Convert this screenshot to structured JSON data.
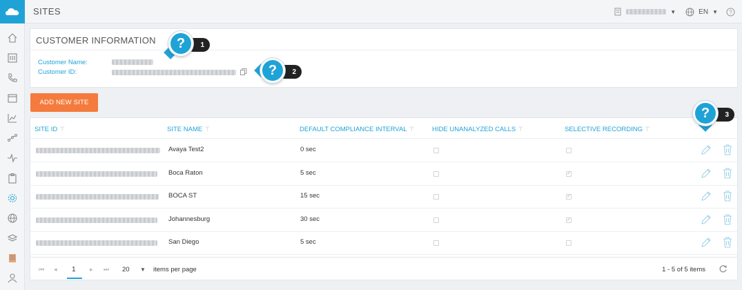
{
  "header": {
    "title": "SITES",
    "language": "EN"
  },
  "sidebar": {
    "icons": [
      "home-icon",
      "dashboard-icon",
      "phone-icon",
      "calendar-icon",
      "chart-icon",
      "analytics-icon",
      "pulse-icon",
      "clipboard-icon",
      "gear-icon",
      "globe-icon",
      "layers-icon",
      "building-icon",
      "users-icon"
    ]
  },
  "customer": {
    "title": "CUSTOMER INFORMATION",
    "name_label": "Customer Name:",
    "id_label": "Customer ID:"
  },
  "add_button": {
    "label": "ADD NEW SITE"
  },
  "table": {
    "columns": [
      "SITE ID",
      "SITE NAME",
      "DEFAULT COMPLIANCE INTERVAL",
      "HIDE UNANALYZED CALLS",
      "SELECTIVE RECORDING"
    ],
    "rows": [
      {
        "site_name": "Avaya Test2",
        "interval": "0 sec",
        "hide_unanalyzed": false,
        "selective_recording": false
      },
      {
        "site_name": "Boca Raton",
        "interval": "5 sec",
        "hide_unanalyzed": false,
        "selective_recording": true
      },
      {
        "site_name": "BOCA ST",
        "interval": "15 sec",
        "hide_unanalyzed": false,
        "selective_recording": true
      },
      {
        "site_name": "Johannesburg",
        "interval": "30 sec",
        "hide_unanalyzed": false,
        "selective_recording": true
      },
      {
        "site_name": "San Diego",
        "interval": "5 sec",
        "hide_unanalyzed": false,
        "selective_recording": false
      }
    ]
  },
  "pagination": {
    "current_page": "1",
    "page_size": "20",
    "page_size_label": "items per page",
    "range_text": "1 - 5 of 5 items"
  },
  "help_badges": [
    "1",
    "2",
    "3"
  ],
  "colors": {
    "accent": "#1fa3d6",
    "button": "#f47b3d"
  }
}
